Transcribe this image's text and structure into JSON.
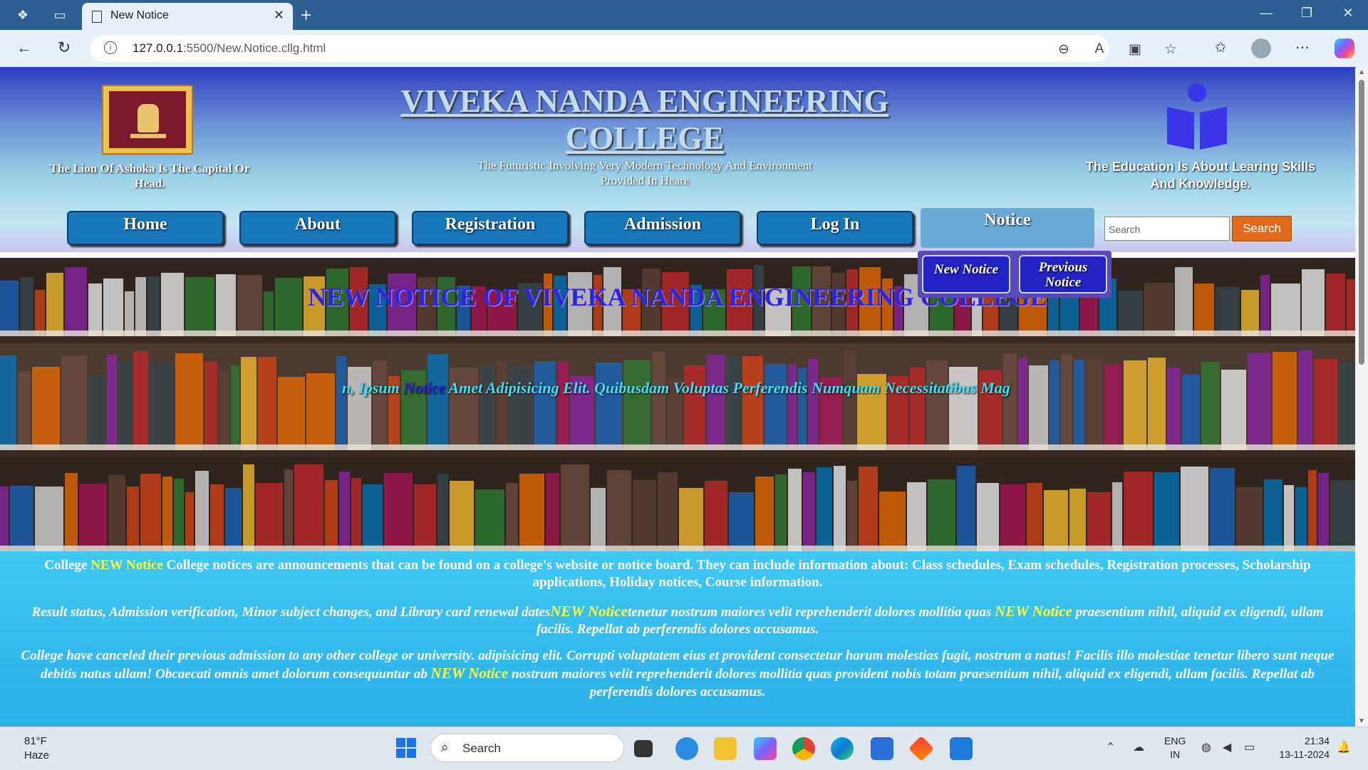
{
  "browser": {
    "tab_title": "New Notice",
    "url_host": "127.0.0.1",
    "url_rest": ":5500/New.Notice.cllg.html"
  },
  "header": {
    "college_name": "VIVEKA NANDA ENGINEERING COLLEGE",
    "tagline": "The Futuristic Involving Very Modern Technology And Environment Provided In Heare",
    "left_caption": "The Lion Of Ashoka Is The Capital Or Head.",
    "right_caption": "The Education Is About Learing Skills And Knowledge."
  },
  "menu": {
    "items": [
      {
        "label": "Home"
      },
      {
        "label": "About"
      },
      {
        "label": "Registration"
      },
      {
        "label": "Admission"
      },
      {
        "label": "Log In"
      },
      {
        "label": "Notice"
      }
    ],
    "search_placeholder": "Search",
    "search_button": "Search",
    "dropdown": {
      "new_notice": "New Notice",
      "previous_notice": "Previous Notice"
    }
  },
  "hero": {
    "title": "NEW NOTICE OF VIVEKA NANDA ENGINEERING COLLEGE",
    "marquee_pre": "n, Ipsum ",
    "marquee_hl": "Notice",
    "marquee_post": " Amet Adipisicing Elit. Quibusdam Voluptas Perferendis Numquam Necessitatibus Mag"
  },
  "notices": {
    "p1_pre": "College ",
    "p1_hl": "NEW Notice",
    "p1_post": " College notices are announcements that can be found on a college's website or notice board. They can include information about: Class schedules, Exam schedules, Registration processes, Scholarship applications, Holiday notices, Course information.",
    "p2_a": "Result status, Admission verification, Minor subject changes, and Library card renewal dates",
    "p2_hl1": "NEW Notice",
    "p2_b": "tenetur nostrum maiores velit reprehenderit dolores mollitia quas ",
    "p2_hl2": "NEW Notice",
    "p2_c": " praesentium nihil, aliquid ex eligendi, ullam facilis. Repellat ab perferendis dolores accusamus.",
    "p3_a": "College have canceled their previous admission to any other college or university. adipisicing elit. Corrupti voluptatem eius et provident consectetur harum molestias fugit, nostrum a natus! Facilis illo molestiae tenetur libero sunt neque debitis natus ullam! Obcaecati omnis amet dolorum consequuntur ab ",
    "p3_hl": "NEW Notice",
    "p3_b": " nostrum maiores velit reprehenderit dolores mollitia quas provident nobis totam praesentium nihil, aliquid ex eligendi, ullam facilis. Repellat ab perferendis dolores accusamus."
  },
  "taskbar": {
    "temp": "81°F",
    "weather": "Haze",
    "search": "Search",
    "lang1": "ENG",
    "lang2": "IN",
    "time": "21:34",
    "date": "13-11-2024"
  },
  "colors": {
    "brand_blue": "#1877b8",
    "search_orange": "#e16a1a",
    "highlight_yellow": "#ffff33",
    "notice_bg": "#3fc8f4"
  }
}
